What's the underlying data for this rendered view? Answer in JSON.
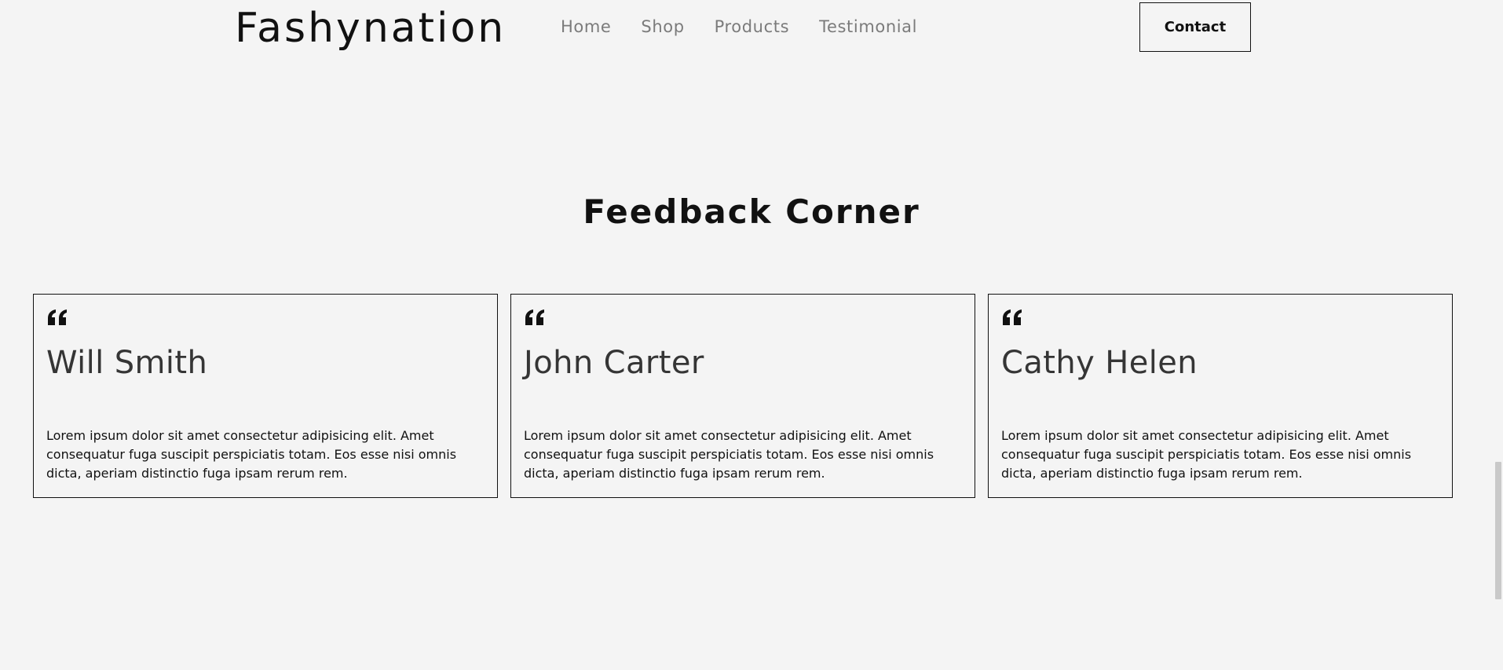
{
  "header": {
    "logo": "Fashynation",
    "nav": [
      "Home",
      "Shop",
      "Products",
      "Testimonial"
    ],
    "cta": "Contact"
  },
  "section": {
    "title": "Feedback Corner"
  },
  "testimonials": [
    {
      "name": "Will Smith",
      "text": "Lorem ipsum dolor sit amet consectetur adipisicing elit. Amet consequatur fuga suscipit perspiciatis totam. Eos esse nisi omnis dicta, aperiam distinctio fuga ipsam rerum rem."
    },
    {
      "name": "John Carter",
      "text": "Lorem ipsum dolor sit amet consectetur adipisicing elit. Amet consequatur fuga suscipit perspiciatis totam. Eos esse nisi omnis dicta, aperiam distinctio fuga ipsam rerum rem."
    },
    {
      "name": "Cathy Helen",
      "text": "Lorem ipsum dolor sit amet consectetur adipisicing elit. Amet consequatur fuga suscipit perspiciatis totam. Eos esse nisi omnis dicta, aperiam distinctio fuga ipsam rerum rem."
    }
  ],
  "icons": {
    "quote": "quote-icon"
  }
}
